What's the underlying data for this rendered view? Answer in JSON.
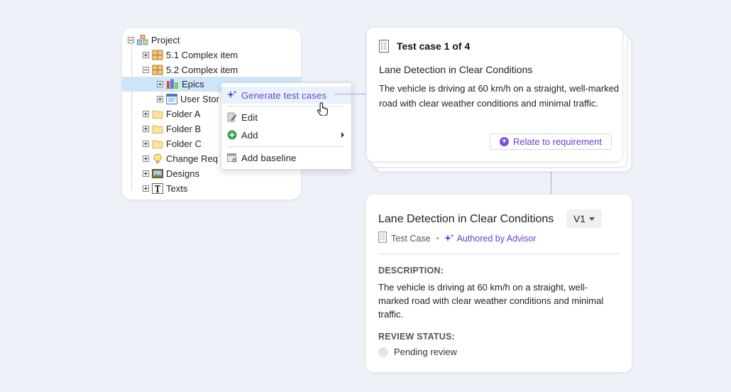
{
  "tree": {
    "root": "Project",
    "items": [
      {
        "label": "5.1 Complex item"
      },
      {
        "label": "5.2 Complex item"
      },
      {
        "label": "Epics"
      },
      {
        "label": "User Stor"
      },
      {
        "label": "Folder A"
      },
      {
        "label": "Folder B"
      },
      {
        "label": "Folder C"
      },
      {
        "label": "Change Req"
      },
      {
        "label": "Designs"
      },
      {
        "label": "Texts"
      }
    ]
  },
  "context_menu": {
    "generate": "Generate test cases",
    "edit": "Edit",
    "add": "Add",
    "add_baseline": "Add baseline"
  },
  "test_case_card": {
    "title": "Test case 1 of 4",
    "name": "Lane Detection in Clear Conditions",
    "description": "The vehicle is driving at 60 km/h on a straight, well-marked road with clear weather conditions and minimal traffic.",
    "relate_button": "Relate to requirement"
  },
  "detail_card": {
    "title": "Lane Detection in Clear Conditions",
    "version": "V1",
    "type": "Test Case",
    "author": "Authored by Advisor",
    "description_label": "DESCRIPTION:",
    "description": "The vehicle is driving at 60 km/h on a straight, well-marked road with clear weather conditions and minimal traffic.",
    "review_label": "REVIEW STATUS:",
    "review_status": "Pending review"
  },
  "colors": {
    "accent": "#6a3fd1",
    "selection": "#cfe6f9",
    "background": "#eef1f8"
  }
}
